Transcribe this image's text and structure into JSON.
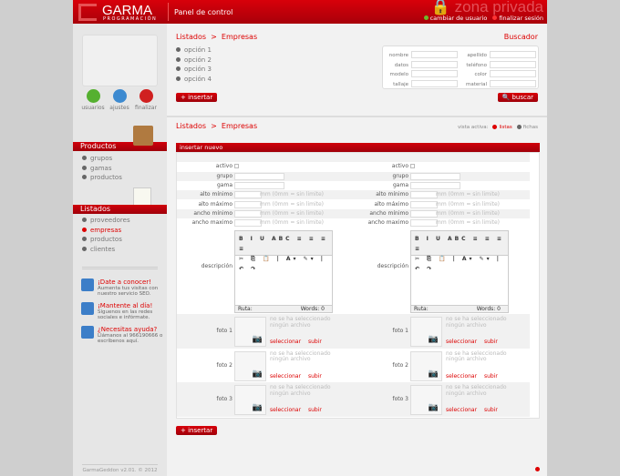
{
  "header": {
    "logo": "GARMA",
    "logo_sub": "PROGRAMACIÓN",
    "title": "Panel de control",
    "zona": "zona privada",
    "change_user": "cambiar de usuario",
    "logout": "finalizar sesión",
    "colors": {
      "green": "#6dbb2a",
      "red": "#d00000"
    }
  },
  "sidebar": {
    "quick": [
      {
        "label": "usuarios",
        "icon": "user-icon",
        "color": "#55b030"
      },
      {
        "label": "ajustes",
        "icon": "gear-icon",
        "color": "#3d8ad0"
      },
      {
        "label": "finalizar",
        "icon": "power-icon",
        "color": "#d02020"
      }
    ],
    "productos": {
      "title": "Productos",
      "items": [
        "grupos",
        "gamas",
        "productos"
      ]
    },
    "listados": {
      "title": "Listados",
      "items": [
        "proveedores",
        "empresas",
        "productos",
        "clientes"
      ],
      "active": 1
    },
    "promos": [
      {
        "title": "¡Date a conocer!",
        "text": "Aumenta tus visitas con nuestro servicio SEO.",
        "icon": "chart-icon"
      },
      {
        "title": "¡Mantente al día!",
        "text": "Síguenos en las redes sociales e infórmate.",
        "icon": "facebook-icon"
      },
      {
        "title": "¿Necesitas ayuda?",
        "text": "Llámanos al 966190666 o escríbenos aquí.",
        "icon": "help-icon"
      }
    ],
    "footer": "GarmaGeddon v2.01. © 2012"
  },
  "top": {
    "breadcrumb": {
      "a": "Listados",
      "sep": ">",
      "b": "Empresas"
    },
    "options": [
      "opción 1",
      "opción 2",
      "opción 3",
      "opción 4"
    ],
    "insert": "+ insertar",
    "search": {
      "title": "Buscador",
      "fields": [
        "nombre",
        "apellido",
        "datos",
        "teléfono",
        "modelo",
        "color",
        "tallaje",
        "material"
      ],
      "button": "buscar"
    }
  },
  "list": {
    "breadcrumb": {
      "a": "Listados",
      "sep": ">",
      "b": "Empresas"
    },
    "view_label": "vista activa:",
    "view_list": "listas",
    "view_cards": "fichas",
    "form_title": "insertar nuevo",
    "fields": {
      "activo": "activo",
      "grupo": "grupo",
      "gama": "gama",
      "alto_min": "alto mínimo",
      "alto_max": "alto máximo",
      "ancho_min": "ancho mínimo",
      "ancho_max": "ancho maximo",
      "hint": "mm (0mm = sin limite)",
      "descripcion": "descripción"
    },
    "editor": {
      "toolbar1": "B I U ABC ≡ ≡ ≡ ≡",
      "toolbar2": "✂ ⎘ 📋 | A▾ ✎▾ | ↶ ↷",
      "path": "Ruta:",
      "words": "Words: 0"
    },
    "photos": {
      "labels": [
        "foto 1",
        "foto 2",
        "foto 3"
      ],
      "none": "no se ha seleccionado ningún archivo",
      "select": "seleccionar",
      "upload": "subir"
    },
    "insert": "+ insertar"
  }
}
